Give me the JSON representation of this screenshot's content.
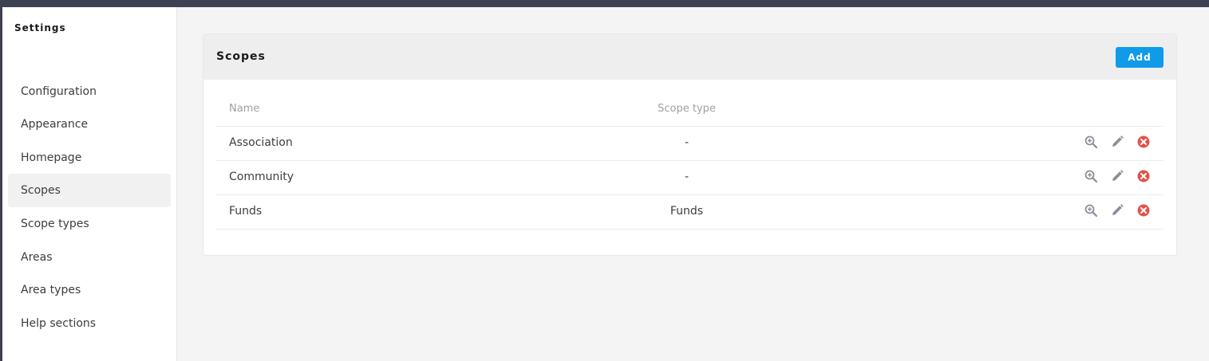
{
  "sidebar": {
    "title": "Settings",
    "items": [
      {
        "label": "Configuration",
        "active": false
      },
      {
        "label": "Appearance",
        "active": false
      },
      {
        "label": "Homepage",
        "active": false
      },
      {
        "label": "Scopes",
        "active": true
      },
      {
        "label": "Scope types",
        "active": false
      },
      {
        "label": "Areas",
        "active": false
      },
      {
        "label": "Area types",
        "active": false
      },
      {
        "label": "Help sections",
        "active": false
      }
    ]
  },
  "card": {
    "title": "Scopes",
    "add_label": "Add"
  },
  "table": {
    "columns": [
      "Name",
      "Scope type"
    ],
    "rows": [
      {
        "name": "Association",
        "scope_type": "-"
      },
      {
        "name": "Community",
        "scope_type": "-"
      },
      {
        "name": "Funds",
        "scope_type": "Funds"
      }
    ],
    "row_actions": [
      "zoom-in-icon",
      "pencil-icon",
      "delete-circle-icon"
    ]
  },
  "colors": {
    "topbar": "#3e4153",
    "accent": "#0f9be8",
    "delete": "#e0534a",
    "icon_gray": "#8a8f99"
  }
}
